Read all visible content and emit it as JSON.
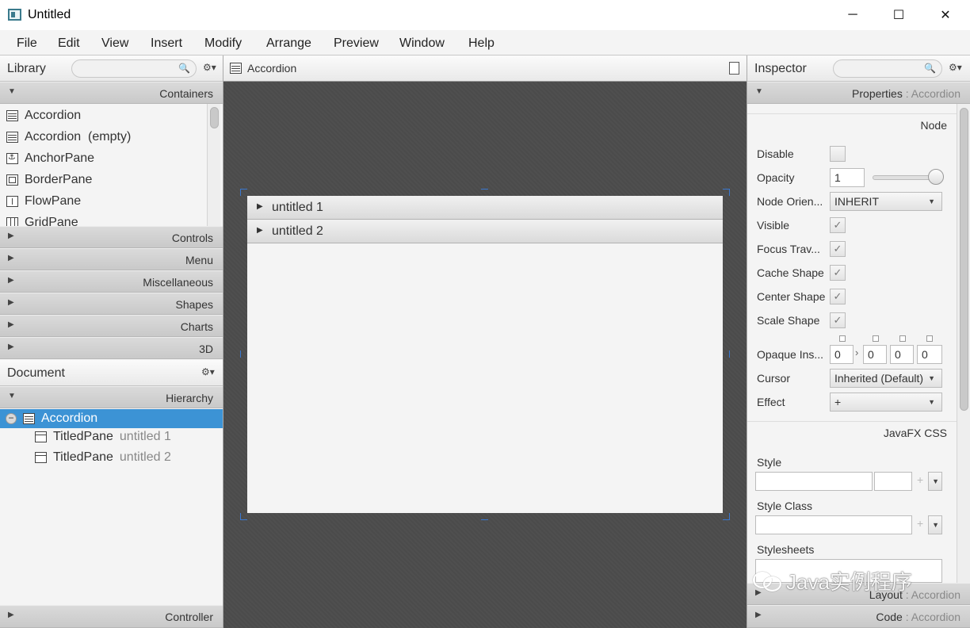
{
  "window": {
    "title": "Untitled",
    "min": "─",
    "max": "☐",
    "close": "✕"
  },
  "menu": [
    "File",
    "Edit",
    "View",
    "Insert",
    "Modify",
    "Arrange",
    "Preview",
    "Window",
    "Help"
  ],
  "library": {
    "title": "Library",
    "gear": "⚙▾",
    "search_icon": "🔍",
    "sections": {
      "containers": "Containers",
      "controls": "Controls",
      "menu": "Menu",
      "miscellaneous": "Miscellaneous",
      "shapes": "Shapes",
      "charts": "Charts",
      "three_d": "3D"
    },
    "items": [
      "Accordion",
      "Accordion  (empty)",
      "AnchorPane",
      "BorderPane",
      "FlowPane",
      "GridPane"
    ]
  },
  "document": {
    "title": "Document",
    "gear": "⚙▾",
    "hierarchy": "Hierarchy",
    "controller": "Controller",
    "tree": {
      "root": "Accordion",
      "children": [
        {
          "type": "TitledPane",
          "name": "untitled 1"
        },
        {
          "type": "TitledPane",
          "name": "untitled 2"
        }
      ]
    }
  },
  "center": {
    "title": "Accordion",
    "panes": [
      "untitled 1",
      "untitled 2"
    ]
  },
  "inspector": {
    "title": "Inspector",
    "gear": "⚙▾",
    "search_icon": "🔍",
    "properties_label": "Properties",
    "properties_target": " : Accordion",
    "node_header": "Node",
    "labels": {
      "disable": "Disable",
      "opacity": "Opacity",
      "node_orientation": "Node Orien...",
      "visible": "Visible",
      "focus_traversable": "Focus Trav...",
      "cache_shape": "Cache Shape",
      "center_shape": "Center Shape",
      "scale_shape": "Scale Shape",
      "opaque_insets": "Opaque Ins...",
      "cursor": "Cursor",
      "effect": "Effect"
    },
    "checks": {
      "disable": "",
      "visible": "✓",
      "focus": "✓",
      "cache": "✓",
      "center": "✓",
      "scale": "✓"
    },
    "opacity_value": "1",
    "opacity_level": 1.0,
    "node_orientation_value": "INHERIT",
    "insets": [
      "0",
      "0",
      "0",
      "0"
    ],
    "insets_sep": "›",
    "cursor_value": "Inherited (Default)",
    "effect_value": "+",
    "css_header": "JavaFX CSS",
    "style_label": "Style",
    "style_class_label": "Style Class",
    "stylesheets_label": "Stylesheets",
    "plus": "+",
    "layout_label": "Layout",
    "layout_target": " : Accordion",
    "code_label": "Code",
    "code_target": " : Accordion"
  },
  "watermark": {
    "text": "Java实例程序"
  }
}
